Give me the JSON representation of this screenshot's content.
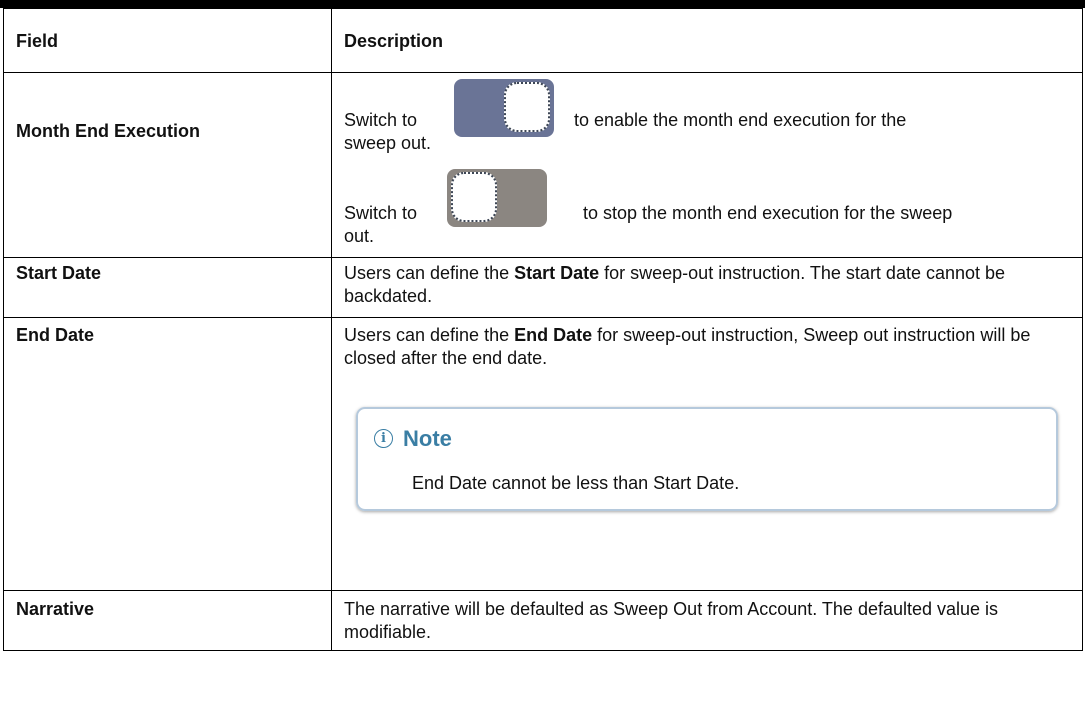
{
  "table": {
    "headers": {
      "field": "Field",
      "description": "Description"
    },
    "rows": {
      "month_end": {
        "field": "Month End Execution",
        "enable": {
          "prefix": "Switch to",
          "text": "to enable the month end execution for the",
          "text2": "sweep out.",
          "icon": "toggle-on"
        },
        "disable": {
          "prefix": "Switch to",
          "text": "to stop the month end execution for the sweep",
          "text2": "out.",
          "icon": "toggle-off"
        }
      },
      "start_date": {
        "field": "Start Date",
        "pre": "Users can define the ",
        "bold": "Start Date",
        "post": " for sweep-out instruction. The start date cannot be backdated."
      },
      "end_date": {
        "field": "End Date",
        "pre": "Users can define the ",
        "bold": "End Date",
        "post": " for sweep-out instruction, Sweep out instruction will be closed after the end date.",
        "note": {
          "title": "Note",
          "text": "End Date cannot be less than Start Date.",
          "icon": "info-icon"
        }
      },
      "narrative": {
        "field": "Narrative",
        "text": "The narrative will be defaulted as Sweep Out from Account. The defaulted value is modifiable."
      }
    }
  },
  "colors": {
    "toggle_on": "#6a7496",
    "toggle_off": "#8b8681",
    "note_accent": "#3a7ea4",
    "note_border": "#b5c9dc"
  }
}
